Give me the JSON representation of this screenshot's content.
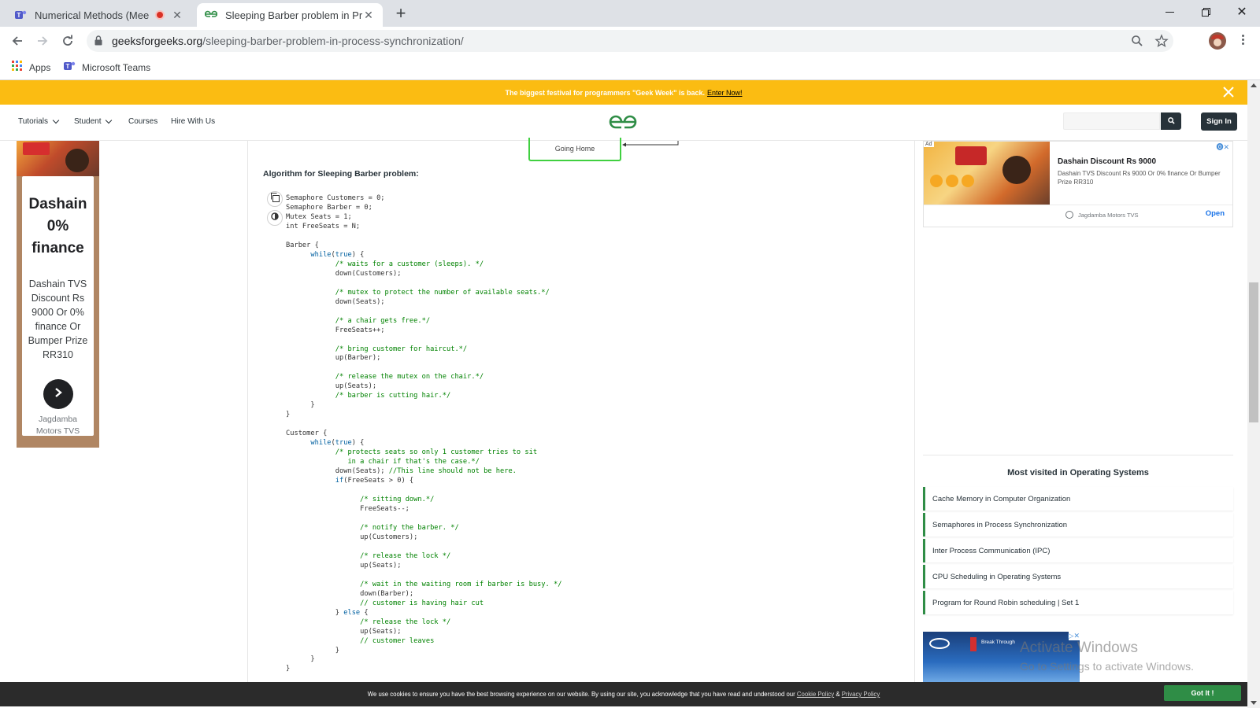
{
  "browser": {
    "tabs": [
      {
        "title": "Numerical Methods (Meeting",
        "recording": true
      },
      {
        "title": "Sleeping Barber problem in Proc",
        "active": true
      }
    ],
    "url_host": "geeksforgeeks.org",
    "url_path": "/sleeping-barber-problem-in-process-synchronization/",
    "bookmarks": [
      "Apps",
      "Microsoft Teams"
    ]
  },
  "promo": {
    "text": "The biggest festival for programmers \"Geek Week\" is back.",
    "link": "Enter Now!"
  },
  "site_nav": {
    "items": [
      "Tutorials",
      "Student",
      "Courses",
      "Hire With Us"
    ],
    "sign_in": "Sign In"
  },
  "diagram_fragment": {
    "box_label": "Going Home"
  },
  "article": {
    "heading": "Algorithm for Sleeping Barber problem:"
  },
  "left_ad": {
    "headline": "Dashain 0% finance",
    "body": "Dashain TVS Discount Rs 9000 Or 0% finance Or Bumper Prize RR310",
    "advertiser": "Jagdamba Motors TVS"
  },
  "right_ad": {
    "badge": "Ad",
    "title": "Dashain Discount Rs 9000",
    "description": "Dashain TVS Discount Rs 9000 Or 0% finance Or Bumper Prize RR310",
    "advertiser": "Jagdamba Motors TVS",
    "cta": "Open"
  },
  "most_visited": {
    "heading": "Most visited in Operating Systems",
    "items": [
      "Cache Memory in Computer Organization",
      "Semaphores in Process Synchronization",
      "Inter Process Communication (IPC)",
      "CPU Scheduling in Operating Systems",
      "Program for Round Robin scheduling | Set 1"
    ]
  },
  "bottom_ad": {
    "text": "Break Through"
  },
  "watermark": {
    "line1": "Activate Windows",
    "line2": "Go to Settings to activate Windows."
  },
  "cookie_bar": {
    "text": "We use cookies to ensure you have the best browsing experience on our website. By using our site, you acknowledge that you have read and understood our",
    "cookie_policy": "Cookie Policy",
    "amp": "&",
    "privacy_policy": "Privacy Policy",
    "button": "Got It !"
  },
  "code_lines": [
    [
      [
        "p",
        "Semaphore Customers = 0;"
      ]
    ],
    [
      [
        "p",
        "Semaphore Barber = 0;"
      ]
    ],
    [
      [
        "p",
        "Mutex Seats = 1;"
      ]
    ],
    [
      [
        "p",
        "int FreeSeats = N;"
      ]
    ],
    [
      [
        "p",
        ""
      ]
    ],
    [
      [
        "p",
        "Barber {"
      ]
    ],
    [
      [
        "p",
        "      "
      ],
      [
        "k",
        "while"
      ],
      [
        "p",
        "("
      ],
      [
        "k",
        "true"
      ],
      [
        "p",
        ") {"
      ]
    ],
    [
      [
        "p",
        "            "
      ],
      [
        "c",
        "/* waits for a customer (sleeps). */"
      ]
    ],
    [
      [
        "p",
        "            down(Customers);"
      ]
    ],
    [
      [
        "p",
        ""
      ]
    ],
    [
      [
        "p",
        "            "
      ],
      [
        "c",
        "/* mutex to protect the number of available seats.*/"
      ]
    ],
    [
      [
        "p",
        "            down(Seats);"
      ]
    ],
    [
      [
        "p",
        ""
      ]
    ],
    [
      [
        "p",
        "            "
      ],
      [
        "c",
        "/* a chair gets free.*/"
      ]
    ],
    [
      [
        "p",
        "            FreeSeats++;"
      ]
    ],
    [
      [
        "p",
        ""
      ]
    ],
    [
      [
        "p",
        "            "
      ],
      [
        "c",
        "/* bring customer for haircut.*/"
      ]
    ],
    [
      [
        "p",
        "            up(Barber);"
      ]
    ],
    [
      [
        "p",
        ""
      ]
    ],
    [
      [
        "p",
        "            "
      ],
      [
        "c",
        "/* release the mutex on the chair.*/"
      ]
    ],
    [
      [
        "p",
        "            up(Seats);"
      ]
    ],
    [
      [
        "p",
        "            "
      ],
      [
        "c",
        "/* barber is cutting hair.*/"
      ]
    ],
    [
      [
        "p",
        "      }"
      ]
    ],
    [
      [
        "p",
        "}"
      ]
    ],
    [
      [
        "p",
        ""
      ]
    ],
    [
      [
        "p",
        "Customer {"
      ]
    ],
    [
      [
        "p",
        "      "
      ],
      [
        "k",
        "while"
      ],
      [
        "p",
        "("
      ],
      [
        "k",
        "true"
      ],
      [
        "p",
        ") {"
      ]
    ],
    [
      [
        "p",
        "            "
      ],
      [
        "c",
        "/* protects seats so only 1 customer tries to sit"
      ]
    ],
    [
      [
        "c",
        "               in a chair if that's the case.*/"
      ]
    ],
    [
      [
        "p",
        "            down(Seats); "
      ],
      [
        "c",
        "//This line should not be here."
      ]
    ],
    [
      [
        "p",
        "            "
      ],
      [
        "k",
        "if"
      ],
      [
        "p",
        "(FreeSeats > 0) {"
      ]
    ],
    [
      [
        "p",
        ""
      ]
    ],
    [
      [
        "p",
        "                  "
      ],
      [
        "c",
        "/* sitting down.*/"
      ]
    ],
    [
      [
        "p",
        "                  FreeSeats--;"
      ]
    ],
    [
      [
        "p",
        ""
      ]
    ],
    [
      [
        "p",
        "                  "
      ],
      [
        "c",
        "/* notify the barber. */"
      ]
    ],
    [
      [
        "p",
        "                  up(Customers);"
      ]
    ],
    [
      [
        "p",
        ""
      ]
    ],
    [
      [
        "p",
        "                  "
      ],
      [
        "c",
        "/* release the lock */"
      ]
    ],
    [
      [
        "p",
        "                  up(Seats);"
      ]
    ],
    [
      [
        "p",
        ""
      ]
    ],
    [
      [
        "p",
        "                  "
      ],
      [
        "c",
        "/* wait in the waiting room if barber is busy. */"
      ]
    ],
    [
      [
        "p",
        "                  down(Barber);"
      ]
    ],
    [
      [
        "p",
        "                  "
      ],
      [
        "c",
        "// customer is having hair cut"
      ]
    ],
    [
      [
        "p",
        "            } "
      ],
      [
        "k",
        "else"
      ],
      [
        "p",
        " {"
      ]
    ],
    [
      [
        "p",
        "                  "
      ],
      [
        "c",
        "/* release the lock */"
      ]
    ],
    [
      [
        "p",
        "                  up(Seats);"
      ]
    ],
    [
      [
        "p",
        "                  "
      ],
      [
        "c",
        "// customer leaves"
      ]
    ],
    [
      [
        "p",
        "            }"
      ]
    ],
    [
      [
        "p",
        "      }"
      ]
    ],
    [
      [
        "p",
        "}"
      ]
    ]
  ],
  "colors": {
    "brand_green": "#2f8d46",
    "promo_yellow": "#fbbc12",
    "code_keyword": "#0060a0",
    "code_comment": "#008200"
  }
}
